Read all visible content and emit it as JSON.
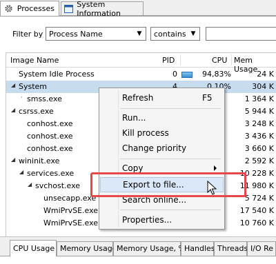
{
  "tabs": [
    {
      "label": "Processes",
      "icon": "gear-icon"
    },
    {
      "label": "System Information",
      "icon": "window-icon"
    }
  ],
  "filter": {
    "label": "Filter by",
    "field": "Process Name",
    "operator": "contains",
    "value": ""
  },
  "table": {
    "columns": [
      "Image Name",
      "PID",
      "CPU",
      "Mem Usage"
    ],
    "rows": [
      {
        "name": "System Idle Process",
        "pid": "0",
        "cpu": "94,83%",
        "mem": "24 K"
      },
      {
        "name": "System",
        "pid": "4",
        "cpu": "0,10%",
        "mem": "304 K"
      },
      {
        "name": "smss.exe",
        "pid": "",
        "cpu": "",
        "mem": "1 364 K"
      },
      {
        "name": "csrss.exe",
        "pid": "",
        "cpu": "",
        "mem": "5 944 K"
      },
      {
        "name": "conhost.exe",
        "pid": "",
        "cpu": "",
        "mem": "3 248 K"
      },
      {
        "name": "conhost.exe",
        "pid": "",
        "cpu": "",
        "mem": "3 436 K"
      },
      {
        "name": "conhost.exe",
        "pid": "",
        "cpu": "",
        "mem": "3 660 K"
      },
      {
        "name": "wininit.exe",
        "pid": "",
        "cpu": "",
        "mem": "2 592 K"
      },
      {
        "name": "services.exe",
        "pid": "",
        "cpu": "",
        "mem": "10 228 K"
      },
      {
        "name": "svchost.exe",
        "pid": "",
        "cpu": "",
        "mem": "11 980 K"
      },
      {
        "name": "unsecapp.exe",
        "pid": "",
        "cpu": "",
        "mem": "5 724 K"
      },
      {
        "name": "WmiPrvSE.exe",
        "pid": "",
        "cpu": "",
        "mem": "17 540 K"
      },
      {
        "name": "WmiPrvSE.exe",
        "pid": "",
        "cpu": "",
        "mem": "10 760 K"
      }
    ]
  },
  "context_menu": {
    "items": [
      {
        "label": "Refresh",
        "shortcut": "F5"
      },
      {
        "label": "Run..."
      },
      {
        "label": "Kill process"
      },
      {
        "label": "Change priority"
      },
      {
        "label": "Copy"
      },
      {
        "label": "Export to file..."
      },
      {
        "label": "Search online..."
      },
      {
        "label": "Properties..."
      }
    ]
  },
  "bottom_tabs": [
    "CPU Usage",
    "Memory Usage",
    "Memory Usage, %",
    "Handles",
    "Threads",
    "I/O Re"
  ],
  "colors": {
    "highlight": "#e8474a",
    "selection": "#c8dcf0"
  }
}
